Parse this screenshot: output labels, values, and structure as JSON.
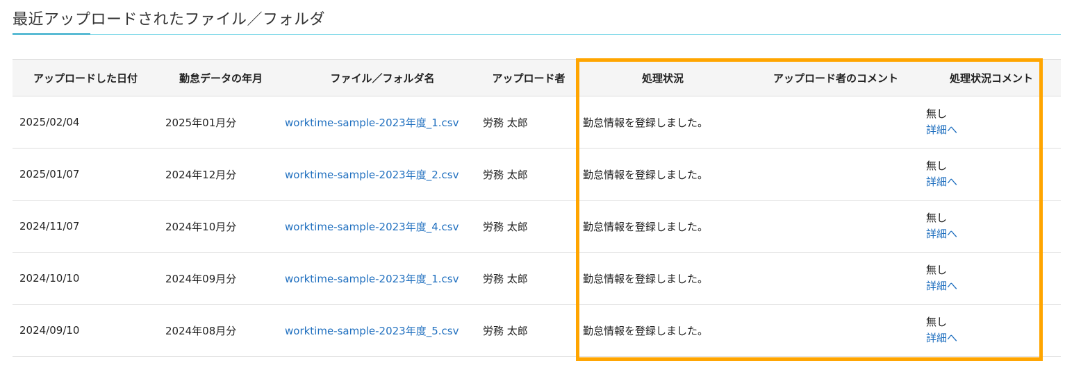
{
  "section": {
    "title": "最近アップロードされたファイル／フォルダ"
  },
  "colors": {
    "highlight": "#ffa500",
    "link": "#1f6fbf",
    "accent_line": "#2aa8c8"
  },
  "table": {
    "headers": {
      "upload_date": "アップロードした日付",
      "attendance_month": "勤怠データの年月",
      "file_name": "ファイル／フォルダ名",
      "uploader": "アップロード者",
      "status": "処理状況",
      "uploader_comment": "アップロード者のコメント",
      "status_comment": "処理状況コメント"
    },
    "rows": [
      {
        "upload_date": "2025/02/04",
        "attendance_month": "2025年01月分",
        "file_name": "worktime-sample-2023年度_1.csv",
        "uploader": "労務 太郎",
        "status": "勤怠情報を登録しました。",
        "uploader_comment": "",
        "status_comment": "無し",
        "detail_link": "詳細へ"
      },
      {
        "upload_date": "2025/01/07",
        "attendance_month": "2024年12月分",
        "file_name": "worktime-sample-2023年度_2.csv",
        "uploader": "労務 太郎",
        "status": "勤怠情報を登録しました。",
        "uploader_comment": "",
        "status_comment": "無し",
        "detail_link": "詳細へ"
      },
      {
        "upload_date": "2024/11/07",
        "attendance_month": "2024年10月分",
        "file_name": "worktime-sample-2023年度_4.csv",
        "uploader": "労務 太郎",
        "status": "勤怠情報を登録しました。",
        "uploader_comment": "",
        "status_comment": "無し",
        "detail_link": "詳細へ"
      },
      {
        "upload_date": "2024/10/10",
        "attendance_month": "2024年09月分",
        "file_name": "worktime-sample-2023年度_1.csv",
        "uploader": "労務 太郎",
        "status": "勤怠情報を登録しました。",
        "uploader_comment": "",
        "status_comment": "無し",
        "detail_link": "詳細へ"
      },
      {
        "upload_date": "2024/09/10",
        "attendance_month": "2024年08月分",
        "file_name": "worktime-sample-2023年度_5.csv",
        "uploader": "労務 太郎",
        "status": "勤怠情報を登録しました。",
        "uploader_comment": "",
        "status_comment": "無し",
        "detail_link": "詳細へ"
      }
    ]
  }
}
